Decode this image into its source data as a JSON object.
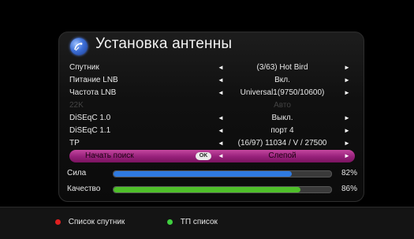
{
  "header": {
    "title": "Установка антенны",
    "logo_icon": "satellite-dish-icon"
  },
  "menu": [
    {
      "label": "Спутник",
      "value": "(3/63) Hot Bird",
      "state": "normal"
    },
    {
      "label": "Питание LNB",
      "value": "Вкл.",
      "state": "normal"
    },
    {
      "label": "Частота LNB",
      "value": "Universal1(9750/10600)",
      "state": "normal"
    },
    {
      "label": "22K",
      "value": "Авто",
      "state": "disabled"
    },
    {
      "label": "DiSEqC 1.0",
      "value": "Выкл.",
      "state": "normal"
    },
    {
      "label": "DiSEqC 1.1",
      "value": "порт 4",
      "state": "normal"
    },
    {
      "label": "TP",
      "value": "(16/97) 11034 / V / 27500",
      "state": "normal"
    },
    {
      "label": "Начать поиск",
      "value": "Слепой",
      "state": "selected",
      "badge": "OK"
    }
  ],
  "signal": {
    "strength": {
      "label": "Сила",
      "percent_text": "82%",
      "level": 0.82,
      "color": "#2f7ae0"
    },
    "quality": {
      "label": "Качество",
      "percent_text": "86%",
      "level": 0.86,
      "color": "#4fbf2a"
    }
  },
  "footer": {
    "red": {
      "label": "Список спутник",
      "color": "#e02020"
    },
    "green": {
      "label": "ТП список",
      "color": "#3fcf3f"
    }
  },
  "arrows": {
    "left": "◄",
    "right": "►"
  }
}
